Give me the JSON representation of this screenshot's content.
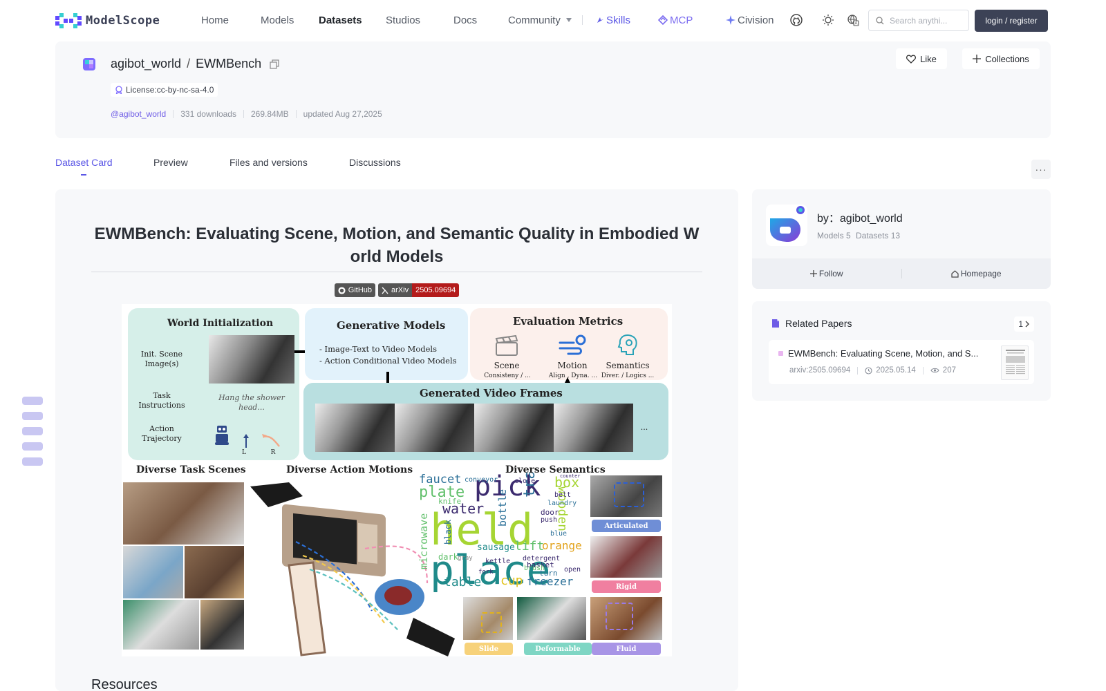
{
  "nav": {
    "brand": "ModelScope",
    "links": [
      "Home",
      "Models",
      "Datasets",
      "Studios",
      "Docs"
    ],
    "community": "Community",
    "skills": "Skills",
    "mcp": "MCP",
    "civision": "Civision",
    "search_placeholder": "Search anythi...",
    "login": "login / register"
  },
  "dataset": {
    "owner": "agibot_world",
    "name": "EWMBench",
    "license": "License:cc-by-nc-sa-4.0",
    "owner_handle": "@agibot_world",
    "downloads": "331 downloads",
    "size": "269.84MB",
    "updated": "updated Aug 27,2025",
    "like": "Like",
    "collections": "Collections"
  },
  "tabs": [
    "Dataset Card",
    "Preview",
    "Files and versions",
    "Discussions"
  ],
  "readme": {
    "title": "EWMBench: Evaluating Scene, Motion, and Semantic Quality in Embodied World Models",
    "badge_github": "GitHub",
    "badge_arxiv_label": "arXiv",
    "badge_arxiv_id": "2505.09694",
    "resources_heading": "Resources"
  },
  "figure": {
    "world_init_title": "World Initialization",
    "init_scene": "Init. Scene Image(s)",
    "task_instructions": "Task Instructions",
    "task_example": "Hang the shower head...",
    "action_trajectory": "Action Trajectory",
    "traj_l": "L",
    "traj_r": "R",
    "gen_models_title": "Generative Models",
    "gen_models_line1": "- Image-Text to Video Models",
    "gen_models_line2": "- Action Conditional Video Models",
    "eval_title": "Evaluation Metrics",
    "metric_scene": "Scene",
    "metric_scene_sub": "Consisteny / ...",
    "metric_motion": "Motion",
    "metric_motion_sub": "Align , Dyna. ...",
    "metric_semantics": "Semantics",
    "metric_semantics_sub": "Diver. / Logics ...",
    "gen_frames_title": "Generated Video Frames",
    "frames_more": "...",
    "diverse_scenes": "Diverse Task Scenes",
    "diverse_actions": "Diverse Action Motions",
    "diverse_semantics": "Diverse Semantics",
    "tag_articulated": "Articulated",
    "tag_rigid": "Rigid",
    "tag_slide": "Slide",
    "tag_deformable": "Deformable",
    "tag_fluid": "Fluid",
    "wordcloud": [
      "held",
      "place",
      "pick",
      "plate",
      "faucet",
      "water",
      "box",
      "tray",
      "bottle",
      "lift",
      "orange",
      "table",
      "cup",
      "freezer",
      "wooden",
      "microwave",
      "black",
      "sausage",
      "knife",
      "basket",
      "turn",
      "door",
      "push",
      "laundry",
      "belt",
      "close",
      "conveyor",
      "dark",
      "detergent",
      "blue",
      "kettle",
      "brush",
      "open",
      "counter",
      "fork",
      "gray"
    ]
  },
  "author": {
    "by_label": "by：agibot_world",
    "models": "Models 5",
    "datasets": "Datasets 13",
    "follow": "Follow",
    "homepage": "Homepage"
  },
  "papers": {
    "heading": "Related Papers",
    "count": "1",
    "item_title": "EWMBench: Evaluating Scene, Motion, and S...",
    "item_arxiv": "arxiv:2505.09694",
    "item_date": "2025.05.14",
    "item_views": "207"
  }
}
